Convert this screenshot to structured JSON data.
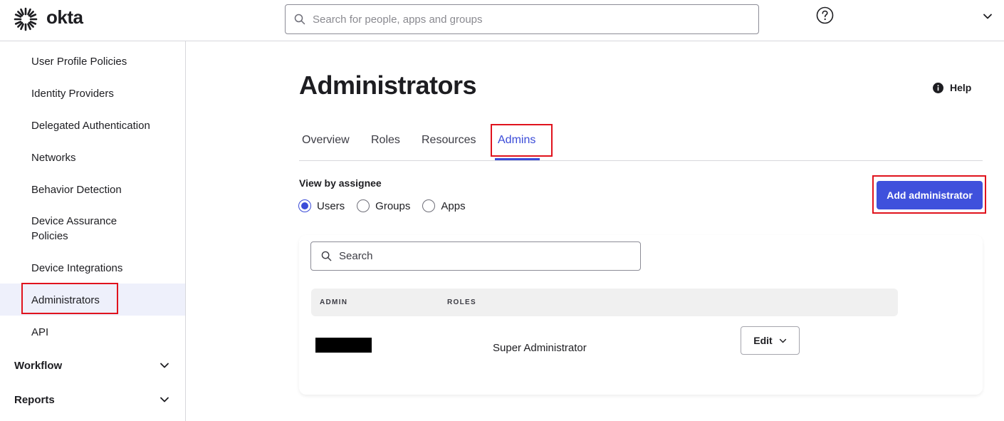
{
  "app": {
    "brand": "okta"
  },
  "global_search": {
    "placeholder": "Search for people, apps and groups"
  },
  "sidebar": {
    "items": [
      {
        "label": "User Profile Policies"
      },
      {
        "label": "Identity Providers"
      },
      {
        "label": "Delegated Authentication"
      },
      {
        "label": "Networks"
      },
      {
        "label": "Behavior Detection"
      },
      {
        "label": "Device Assurance Policies"
      },
      {
        "label": "Device Integrations"
      },
      {
        "label": "Administrators",
        "active": true
      },
      {
        "label": "API"
      }
    ],
    "sections": [
      {
        "label": "Workflow"
      },
      {
        "label": "Reports"
      }
    ]
  },
  "page": {
    "title": "Administrators",
    "help_label": "Help",
    "tabs": [
      {
        "label": "Overview"
      },
      {
        "label": "Roles"
      },
      {
        "label": "Resources"
      },
      {
        "label": "Admins",
        "active": true
      }
    ],
    "view_by": {
      "label": "View by assignee",
      "options": [
        {
          "label": "Users",
          "checked": true
        },
        {
          "label": "Groups",
          "checked": false
        },
        {
          "label": "Apps",
          "checked": false
        }
      ]
    },
    "add_button_label": "Add administrator",
    "table": {
      "search_placeholder": "Search",
      "columns": [
        "ADMIN",
        "ROLES"
      ],
      "rows": [
        {
          "admin": "",
          "role": "Super Administrator",
          "action": "Edit"
        }
      ]
    }
  },
  "colors": {
    "accent": "#3f51dc",
    "highlight": "#e0131d",
    "active_bg": "#eef0fb"
  }
}
